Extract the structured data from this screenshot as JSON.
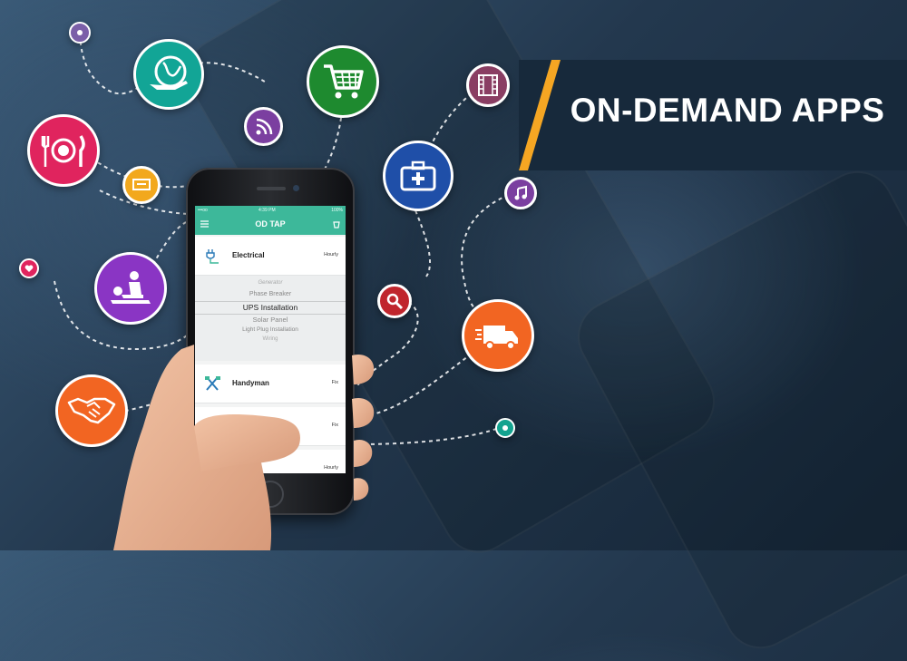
{
  "banner": {
    "title": "ON-DEMAND APPS"
  },
  "phone": {
    "status": {
      "carrier": "•••oo",
      "time": "4:39 PM",
      "battery": "100%"
    },
    "app_title": "OD TAP",
    "services": [
      {
        "label": "Electrical",
        "rate": "Hourly",
        "icon": "plug-icon"
      },
      {
        "label": "Handyman",
        "rate": "Fix",
        "icon": "tools-icon"
      },
      {
        "label": "",
        "rate": "Fix",
        "icon": "magnet-icon"
      },
      {
        "label": "iry",
        "rate": "Hourly",
        "icon": "partial-icon"
      }
    ],
    "picker": {
      "options": [
        "Generator",
        "Phase Breaker",
        "UPS Installation",
        "Solar Panel",
        "Light Plug Installation",
        "Wiring"
      ],
      "selected": "UPS Installation"
    }
  },
  "icons": [
    "globe-plane-icon",
    "shopping-cart-icon",
    "film-icon",
    "restaurant-icon",
    "rss-icon",
    "money-icon",
    "medical-kit-icon",
    "music-icon",
    "massage-icon",
    "search-icon",
    "heart-icon",
    "delivery-truck-icon",
    "handshake-icon"
  ],
  "colors": {
    "teal": "#1aa89a",
    "green": "#1e8e3e",
    "red": "#e0245e",
    "purple": "#7b3fa0",
    "orange": "#f26522",
    "blue": "#1f4fa8",
    "accent": "#f5a623"
  }
}
